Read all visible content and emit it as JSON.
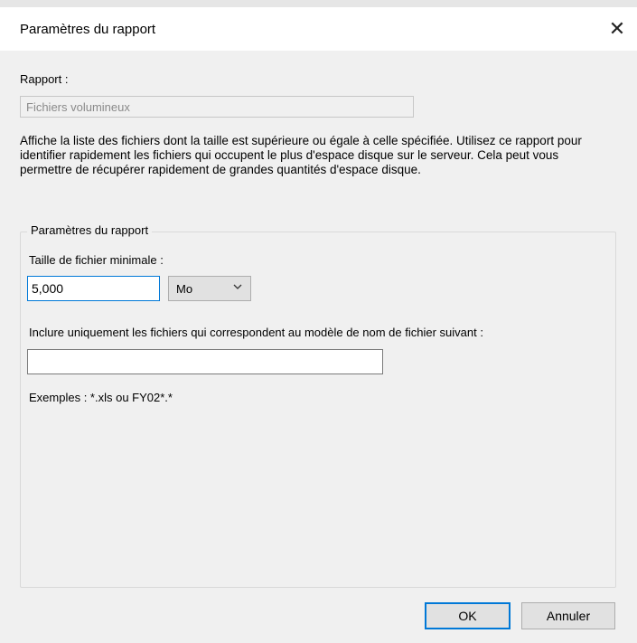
{
  "dialog": {
    "title": "Paramètres du rapport",
    "close_icon": "close-icon"
  },
  "report": {
    "label": "Rapport :",
    "name": "Fichiers volumineux",
    "description": "Affiche la liste des fichiers dont la taille est supérieure ou égale à celle spécifiée. Utilisez ce rapport pour identifier rapidement les fichiers qui occupent le plus d'espace disque sur le serveur. Cela peut vous permettre de récupérer rapidement de grandes quantités d'espace disque."
  },
  "params": {
    "group_label": "Paramètres du rapport",
    "min_size_label": "Taille de fichier minimale :",
    "min_size_value": "5,000",
    "unit_value": "Mo",
    "pattern_label": "Inclure uniquement les fichiers qui correspondent au modèle de nom de fichier suivant :",
    "pattern_value": "",
    "examples": "Exemples : *.xls ou FY02*.*"
  },
  "buttons": {
    "ok": "OK",
    "cancel": "Annuler"
  },
  "colors": {
    "accent": "#0078d7",
    "dialog_bg": "#f0f0f0"
  }
}
